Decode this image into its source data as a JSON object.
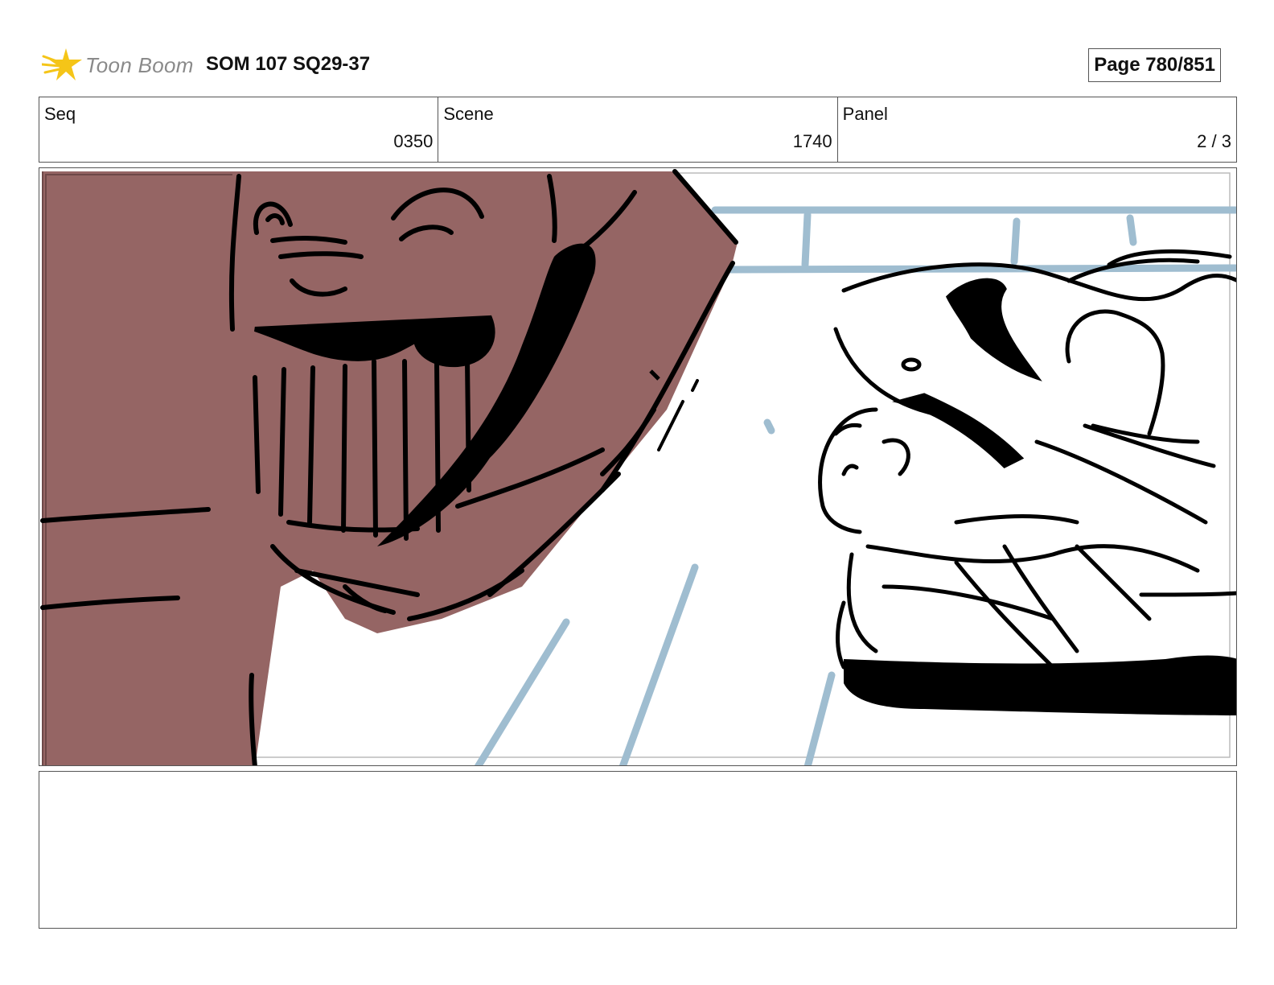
{
  "header": {
    "logo_text": "Toon Boom",
    "title": "SOM 107 SQ29-37",
    "page": "Page 780/851"
  },
  "info": {
    "seq": {
      "label": "Seq",
      "value": "0350"
    },
    "scene": {
      "label": "Scene",
      "value": "1740"
    },
    "panel": {
      "label": "Panel",
      "value": "2 / 3"
    }
  },
  "colors": {
    "skin_fill": "#956564",
    "background_lines": "#9fbdd0",
    "ink": "#000000",
    "logo_star": "#f5c518"
  },
  "icons": {
    "logo": "toon-boom-star-icon"
  }
}
